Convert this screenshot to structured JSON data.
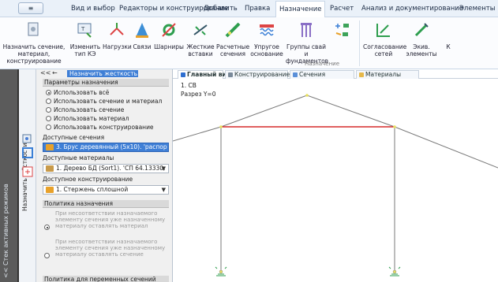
{
  "menubar": {
    "app_button": "≡",
    "items": [
      {
        "label": "Вид и выбор"
      },
      {
        "label": "Редакторы и конструирование"
      },
      {
        "label": "Добавить"
      },
      {
        "label": "Правка"
      },
      {
        "label": "Назначение",
        "active": true
      },
      {
        "label": "Расчет"
      },
      {
        "label": "Анализ и документирование"
      },
      {
        "label": "Элементы"
      }
    ]
  },
  "ribbon": {
    "buttons": [
      {
        "label": "Назначить сечение, материал,\nконструирование",
        "icon": "assign-section-icon"
      },
      {
        "label": "Изменить\nтип КЭ",
        "icon": "change-fe-type-icon"
      },
      {
        "label": "Нагрузки",
        "icon": "loads-icon"
      },
      {
        "label": "Связи",
        "icon": "supports-icon"
      },
      {
        "label": "Шарниры",
        "icon": "hinges-icon"
      },
      {
        "label": "Жесткие\nвставки",
        "icon": "rigid-inserts-icon"
      },
      {
        "label": "Расчетные\nсечения",
        "icon": "design-sections-icon"
      },
      {
        "label": "Упругое\nоснование",
        "icon": "elastic-foundation-icon"
      },
      {
        "label": "Группы свай и\nфундаментов",
        "icon": "pile-groups-icon"
      },
      {
        "label": "Согласование\nсетей",
        "icon": "mesh-matching-icon"
      },
      {
        "label": "Экив.\nэлементы",
        "icon": "equiv-elements-icon"
      },
      {
        "label": "К",
        "icon": "more-icon"
      }
    ],
    "group_label": "Назначение"
  },
  "side": {
    "strip_label": "<< Стек активных режимов",
    "tool_label": "Назначить жёсткости"
  },
  "panel": {
    "nav_back": "<<",
    "nav_arrow": "←",
    "header_chip": "Назначить жесткость",
    "params_title": "Параметры назначения",
    "options": [
      {
        "label": "Использовать всё",
        "checked": true
      },
      {
        "label": "Использовать сечение и материал",
        "checked": false
      },
      {
        "label": "Использовать сечение",
        "checked": false
      },
      {
        "label": "Использовать материал",
        "checked": false
      },
      {
        "label": "Использовать конструирование",
        "checked": false
      }
    ],
    "sections_label": "Доступные сечения",
    "section_value": "3. Брус деревянный (5x10). 'распор",
    "materials_label": "Доступные материалы",
    "material_value": "1. Дерево БД (Sort1). 'СП 64.13330.",
    "design_label": "Доступное конструирование",
    "design_value": "1. Стержень сплошной",
    "policy_title": "Политика назначения",
    "policy_options": [
      {
        "text": "При несоответствии назначаемого элементу сечения уже назначенному материалу оставлять материал",
        "checked": true
      },
      {
        "text": "При несоответствии назначаемого элементу сечения уже назначенному материалу оставлять сечение",
        "checked": false
      }
    ],
    "policy2_title": "Политика для переменных сечений"
  },
  "view": {
    "tabs": [
      {
        "label": "Главный вид",
        "active": true,
        "color": "#2f6fd0"
      },
      {
        "label": "Конструирование",
        "active": false,
        "color": "#7a8a9a"
      },
      {
        "label": "Сечения",
        "active": false,
        "color": "#5a8fd8"
      },
      {
        "label": "Материалы",
        "active": false,
        "color": "#e6b84a"
      }
    ],
    "case_label": "1. СВ",
    "cut_label": "Разрез Y=0"
  },
  "colors": {
    "accent": "#3f7fd6",
    "highlight_beam": "#d62a2a",
    "frame_line": "#7a7a7a",
    "node_yellow": "#e8e060"
  }
}
